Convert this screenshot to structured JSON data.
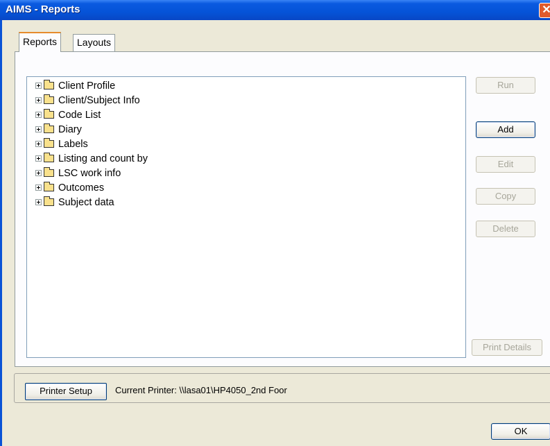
{
  "window": {
    "title": "AIMS - Reports",
    "close_glyph": "✕"
  },
  "tabs": [
    {
      "label": "Reports",
      "active": true
    },
    {
      "label": "Layouts",
      "active": false
    }
  ],
  "tree": {
    "items": [
      {
        "label": "Client Profile",
        "icon": "folder-icon"
      },
      {
        "label": "Client/Subject Info",
        "icon": "folder-icon"
      },
      {
        "label": "Code List",
        "icon": "folder-icon"
      },
      {
        "label": "Diary",
        "icon": "folder-icon"
      },
      {
        "label": "Labels",
        "icon": "folder-icon"
      },
      {
        "label": "Listing and count by",
        "icon": "folder-icon"
      },
      {
        "label": "LSC work info",
        "icon": "folder-icon"
      },
      {
        "label": "Outcomes",
        "icon": "folder-icon"
      },
      {
        "label": "Subject data",
        "icon": "folder-icon"
      }
    ]
  },
  "actions": {
    "run": "Run",
    "add": "Add",
    "edit": "Edit",
    "copy": "Copy",
    "delete": "Delete",
    "print_details": "Print Details"
  },
  "printer": {
    "setup_label": "Printer Setup",
    "current_text": "Current Printer: \\\\lasa01\\HP4050_2nd Foor"
  },
  "footer": {
    "ok": "OK"
  },
  "colors": {
    "titlebar": "#0553d8",
    "window_bg": "#ece9d8",
    "active_tab_accent": "#e68b2c",
    "disabled_text": "#a7a69a",
    "close_button": "#e05a2b"
  }
}
